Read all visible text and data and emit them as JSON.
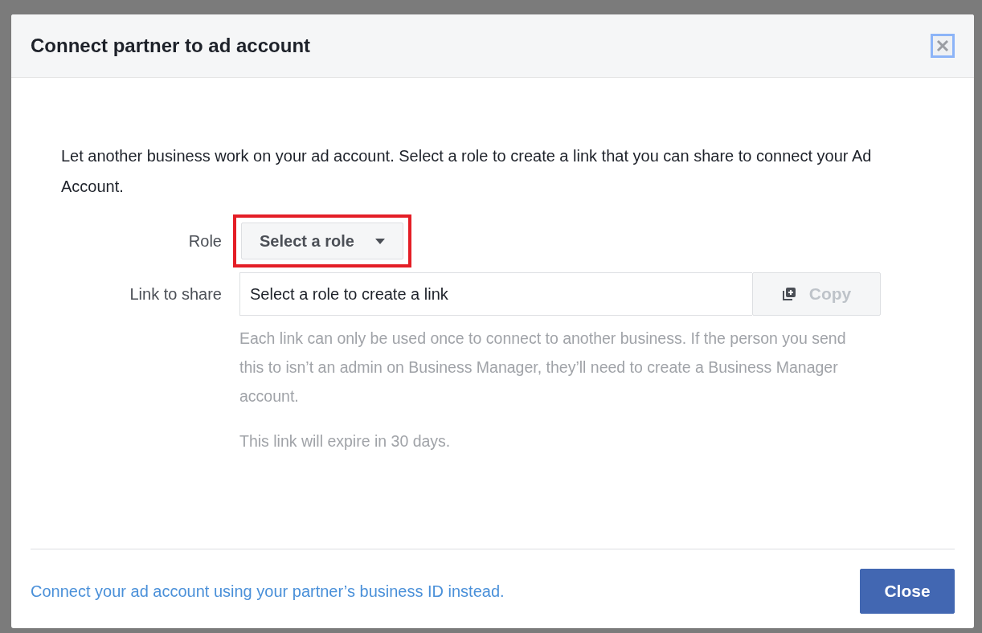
{
  "dialog": {
    "title": "Connect partner to ad account"
  },
  "intro": "Let another business work on your ad account. Select a role to create a link that you can share to connect your Ad Account.",
  "role": {
    "label": "Role",
    "value": "Select a role",
    "highlighted": true
  },
  "link": {
    "label": "Link to share",
    "placeholder": "Select a role to create a link",
    "copy_label": "Copy",
    "copy_disabled": true
  },
  "notes": [
    "Each link can only be used once to connect to another business. If the person you send this to isn’t an admin on Business Manager, they’ll need to create a Business Manager account.",
    "This link will expire in 30 days."
  ],
  "footer": {
    "link": "Connect your ad account using your partner’s business ID instead.",
    "button": "Close"
  }
}
